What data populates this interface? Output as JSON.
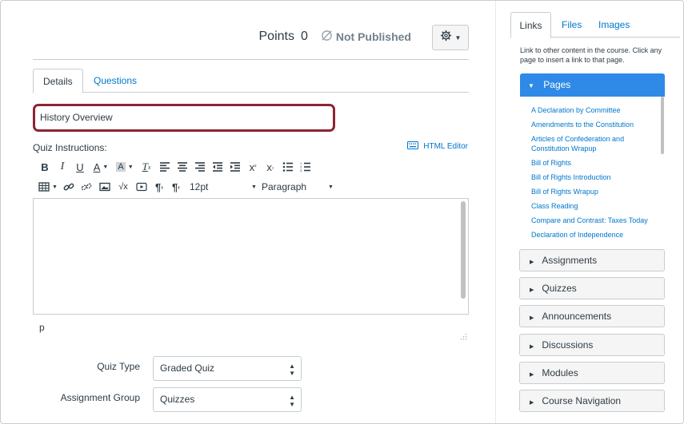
{
  "header": {
    "points_label": "Points",
    "points_value": "0",
    "publish_status": "Not Published",
    "settings_icon": "gear-icon"
  },
  "tabs": [
    {
      "label": "Details",
      "active": true
    },
    {
      "label": "Questions",
      "active": false
    }
  ],
  "quiz": {
    "title_value": "History Overview",
    "instructions_label": "Quiz Instructions:",
    "html_editor_label": "HTML Editor",
    "font_size": "12pt",
    "paragraph_format": "Paragraph",
    "status_path": "p"
  },
  "fields": {
    "quiz_type_label": "Quiz Type",
    "quiz_type_value": "Graded Quiz",
    "assignment_group_label": "Assignment Group",
    "assignment_group_value": "Quizzes"
  },
  "sidebar": {
    "tabs": [
      "Links",
      "Files",
      "Images"
    ],
    "hint": "Link to other content in the course. Click any page to insert a link to that page.",
    "pages_header": "Pages",
    "pages": [
      "A Declaration by Committee",
      "Amendments to the Constitution",
      "Articles of Confederation and Constitution Wrapup",
      "Bill of Rights",
      "Bill of Rights Introduction",
      "Bill of Rights Wrapup",
      "Class Reading",
      "Compare and Contrast: Taxes Today",
      "Declaration of Independence"
    ],
    "sections": [
      "Assignments",
      "Quizzes",
      "Announcements",
      "Discussions",
      "Modules",
      "Course Navigation"
    ]
  },
  "colors": {
    "accent": "#2e8ae6",
    "link": "#0077cc",
    "title_border": "#8d2333",
    "text": "#2d3b45"
  }
}
